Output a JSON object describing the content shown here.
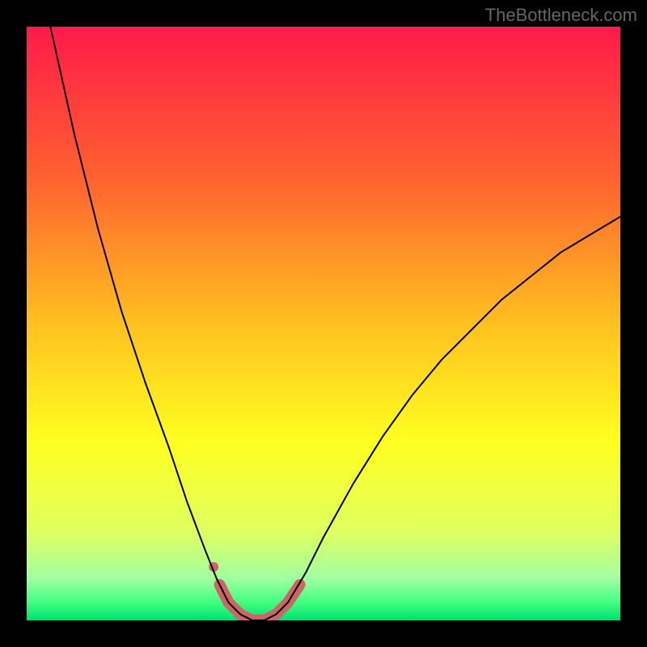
{
  "watermark": "TheBottleneck.com",
  "chart_data": {
    "type": "line",
    "title": "",
    "xlabel": "",
    "ylabel": "",
    "xlim": [
      0,
      100
    ],
    "ylim": [
      0,
      100
    ],
    "background_gradient": {
      "stops": [
        {
          "offset": 0,
          "color": "#ff1a4a"
        },
        {
          "offset": 25,
          "color": "#ff6030"
        },
        {
          "offset": 50,
          "color": "#ffc020"
        },
        {
          "offset": 70,
          "color": "#ffff20"
        },
        {
          "offset": 85,
          "color": "#e0ff60"
        },
        {
          "offset": 93,
          "color": "#a0ffa0"
        },
        {
          "offset": 97,
          "color": "#40ff80"
        },
        {
          "offset": 100,
          "color": "#00e070"
        }
      ]
    },
    "curve": {
      "color": "#000000",
      "stroke_width": 2,
      "points": [
        {
          "x": 4,
          "y": 100
        },
        {
          "x": 8,
          "y": 82
        },
        {
          "x": 12,
          "y": 66
        },
        {
          "x": 16,
          "y": 52
        },
        {
          "x": 20,
          "y": 40
        },
        {
          "x": 24,
          "y": 29
        },
        {
          "x": 27,
          "y": 20
        },
        {
          "x": 30,
          "y": 12
        },
        {
          "x": 32,
          "y": 7
        },
        {
          "x": 34,
          "y": 3
        },
        {
          "x": 36,
          "y": 1
        },
        {
          "x": 38,
          "y": 0
        },
        {
          "x": 40,
          "y": 0
        },
        {
          "x": 42,
          "y": 1
        },
        {
          "x": 44,
          "y": 3
        },
        {
          "x": 47,
          "y": 8
        },
        {
          "x": 50,
          "y": 14
        },
        {
          "x": 55,
          "y": 23
        },
        {
          "x": 60,
          "y": 31
        },
        {
          "x": 65,
          "y": 38
        },
        {
          "x": 70,
          "y": 44
        },
        {
          "x": 75,
          "y": 49
        },
        {
          "x": 80,
          "y": 54
        },
        {
          "x": 85,
          "y": 58
        },
        {
          "x": 90,
          "y": 62
        },
        {
          "x": 95,
          "y": 65
        },
        {
          "x": 100,
          "y": 68
        }
      ]
    },
    "highlight": {
      "color": "#cc6666",
      "stroke_width": 14,
      "segments": [
        [
          {
            "x": 32.5,
            "y": 6
          },
          {
            "x": 34,
            "y": 3
          },
          {
            "x": 36,
            "y": 1
          },
          {
            "x": 38,
            "y": 0
          },
          {
            "x": 40,
            "y": 0
          },
          {
            "x": 42,
            "y": 1
          },
          {
            "x": 44,
            "y": 3
          },
          {
            "x": 46,
            "y": 6
          }
        ]
      ],
      "dot": {
        "x": 31.5,
        "y": 9,
        "r": 6
      }
    }
  }
}
